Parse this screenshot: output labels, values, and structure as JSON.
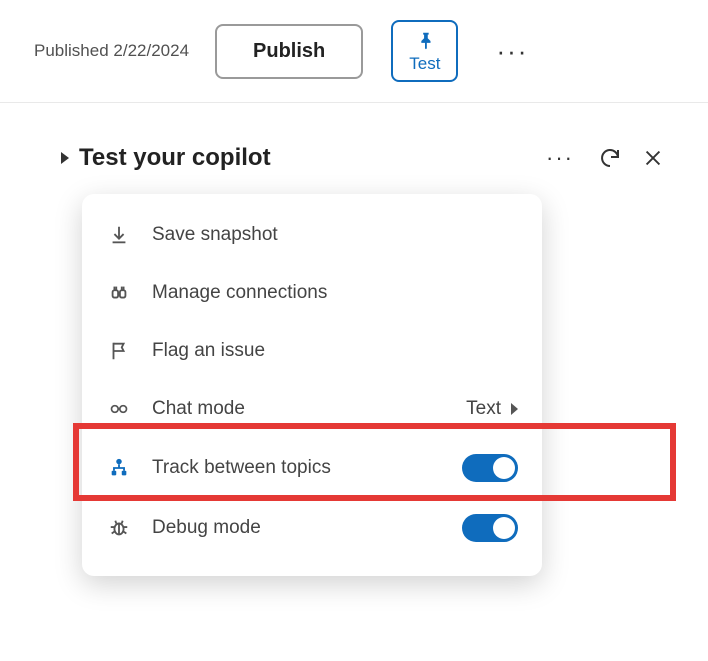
{
  "topbar": {
    "published_label": "Published 2/22/2024",
    "publish_button": "Publish",
    "test_button": "Test"
  },
  "panel": {
    "title": "Test your copilot"
  },
  "menu": {
    "save_snapshot": "Save snapshot",
    "manage_connections": "Manage connections",
    "flag_issue": "Flag an issue",
    "chat_mode": {
      "label": "Chat mode",
      "value": "Text"
    },
    "track_between_topics": {
      "label": "Track between topics",
      "on": true
    },
    "debug_mode": {
      "label": "Debug mode",
      "on": true
    }
  }
}
